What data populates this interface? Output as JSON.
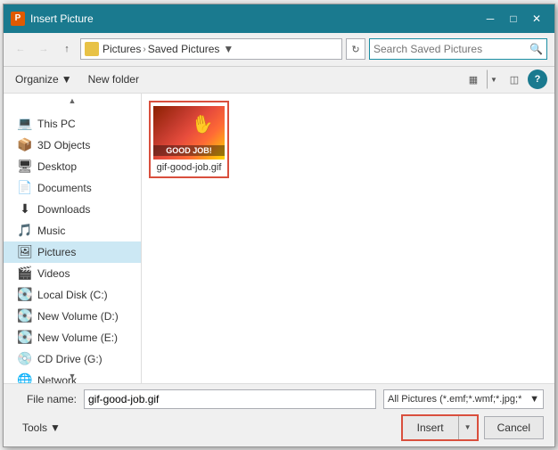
{
  "dialog": {
    "title": "Insert Picture",
    "title_icon": "P"
  },
  "titlebar": {
    "minimize": "─",
    "maximize": "□",
    "close": "✕"
  },
  "nav": {
    "back_disabled": true,
    "forward_disabled": true,
    "up_disabled": false,
    "breadcrumb": {
      "icon": "📁",
      "path_parts": [
        "Pictures",
        "Saved Pictures"
      ],
      "separator": "›"
    }
  },
  "search": {
    "placeholder": "Search Saved Pictures"
  },
  "toolbar2": {
    "organize_label": "Organize",
    "new_folder_label": "New folder",
    "help_label": "?"
  },
  "sidebar": {
    "scroll_up": "▲",
    "scroll_down": "▼",
    "items": [
      {
        "id": "this-pc",
        "label": "This PC",
        "icon": "💻",
        "selected": false
      },
      {
        "id": "3d-objects",
        "label": "3D Objects",
        "icon": "📦",
        "selected": false
      },
      {
        "id": "desktop",
        "label": "Desktop",
        "icon": "🖥",
        "selected": false
      },
      {
        "id": "documents",
        "label": "Documents",
        "icon": "📄",
        "selected": false
      },
      {
        "id": "downloads",
        "label": "Downloads",
        "icon": "⬇",
        "selected": false
      },
      {
        "id": "music",
        "label": "Music",
        "icon": "🎵",
        "selected": false
      },
      {
        "id": "pictures",
        "label": "Pictures",
        "icon": "🖼",
        "selected": true
      },
      {
        "id": "videos",
        "label": "Videos",
        "icon": "🎬",
        "selected": false
      },
      {
        "id": "local-disk-c",
        "label": "Local Disk (C:)",
        "icon": "💽",
        "selected": false
      },
      {
        "id": "new-volume-d",
        "label": "New Volume (D:)",
        "icon": "💽",
        "selected": false
      },
      {
        "id": "new-volume-e",
        "label": "New Volume (E:)",
        "icon": "💽",
        "selected": false
      },
      {
        "id": "cd-drive-g",
        "label": "CD Drive (G:)",
        "icon": "💿",
        "selected": false
      },
      {
        "id": "network",
        "label": "Network",
        "icon": "🌐",
        "selected": false
      }
    ]
  },
  "files": [
    {
      "name": "gif-good-job.gif",
      "thumb_text": "GOOD JOB!",
      "selected": true
    }
  ],
  "bottom": {
    "file_name_label": "File name:",
    "file_name_value": "gif-good-job.gif",
    "file_type_value": "All Pictures (*.emf;*.wmf;*.jpg;*",
    "tools_label": "Tools",
    "insert_label": "Insert",
    "cancel_label": "Cancel"
  }
}
